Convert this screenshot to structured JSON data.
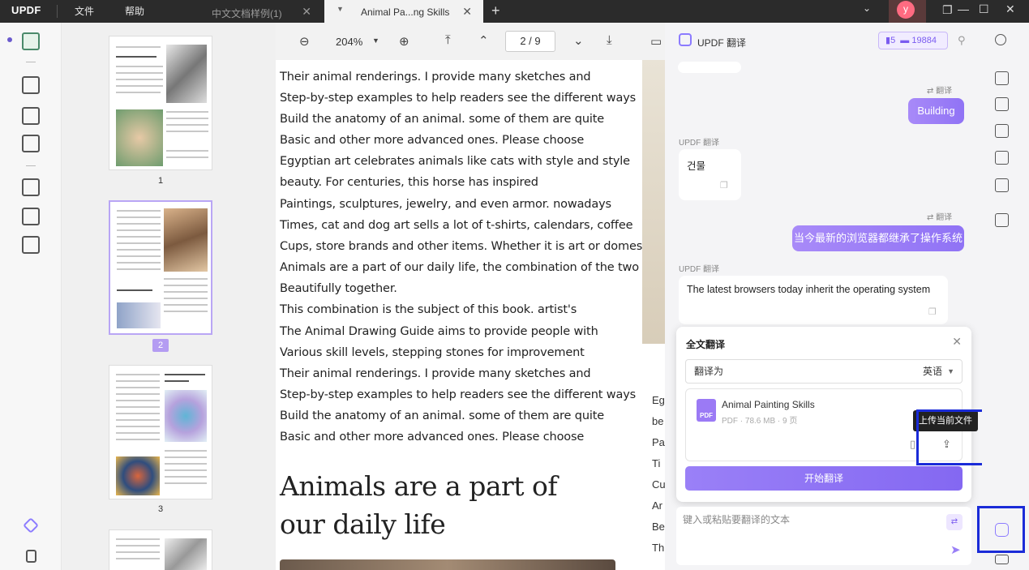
{
  "app": {
    "logo": "UPDF",
    "menu": {
      "file": "文件",
      "help": "帮助"
    },
    "tabs": [
      {
        "label": "中文文档样例(1)",
        "active": false
      },
      {
        "label": "Animal Pa...ng Skills",
        "active": true
      }
    ],
    "user_initial": "y"
  },
  "toolbar": {
    "zoom": "204%",
    "page_current": "2",
    "page_total": "9",
    "page_display": "2 / 9"
  },
  "thumbnails": {
    "pages": [
      "1",
      "2",
      "3"
    ]
  },
  "document": {
    "lines": [
      "Their animal renderings. I provide many sketches and",
      "Step-by-step examples to help readers see the different ways",
      "Build the anatomy of an animal. some of them are quite",
      "Basic and other more advanced ones. Please choose",
      "Egyptian art celebrates animals like cats with style and style",
      "beauty. For centuries, this horse has inspired",
      "Paintings, sculptures, jewelry, and even armor. nowadays",
      "Times, cat and dog art sells a lot of t-shirts, calendars, coffee",
      "Cups, store brands and other items. Whether it is art or domestic",
      "Animals are a part of our daily life, the combination of the two",
      "Beautifully together.",
      "This combination is the subject of this book. artist's",
      "The Animal Drawing Guide aims to provide people with",
      "Various skill levels, stepping stones for improvement",
      "Their animal renderings. I provide many sketches and",
      "Step-by-step examples to help readers see the different ways",
      "Build the anatomy of an animal. some of them are quite",
      "Basic and other more advanced ones. Please choose"
    ],
    "heading_line1": "Animals are a part of",
    "heading_line2": "our daily life",
    "edge_letters": [
      "Eg",
      "be",
      "Pa",
      "Ti",
      "Cu",
      "Ar",
      "Be",
      "Th"
    ]
  },
  "translate_panel": {
    "title": "UPDF 翻译",
    "credit_a": "5",
    "credit_b": "19884",
    "messages": [
      {
        "type": "user",
        "text": "Building"
      },
      {
        "type": "ai",
        "label": "UPDF 翻译",
        "text": "건물"
      },
      {
        "type": "user",
        "text": "当今最新的浏览器都继承了操作系统"
      },
      {
        "type": "ai",
        "label": "UPDF 翻译",
        "text": "The latest browsers today inherit the operating system"
      }
    ],
    "translate_tag": "翻译",
    "full_translation": {
      "title": "全文翻译",
      "translate_to_label": "翻译为",
      "target_language": "英语",
      "file_name": "Animal Painting Skills",
      "file_meta": "PDF · 78.6 MB · 9 页",
      "upload_tooltip": "上传当前文件",
      "start_button": "开始翻译"
    },
    "input_placeholder": "键入或粘贴要翻译的文本"
  }
}
